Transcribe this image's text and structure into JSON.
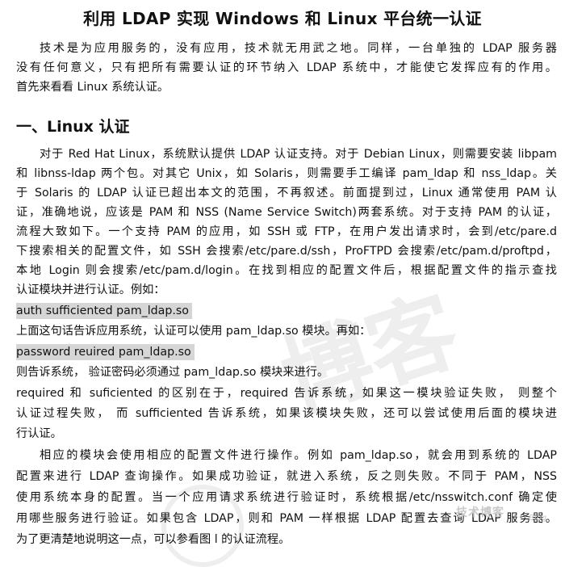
{
  "title": "利用 LDAP 实现 Windows 和 Linux 平台统一认证",
  "intro_lines": [
    "技术是为应用服务的，没有应用，技术就无用武之地。同样，一台单独的 LDAP 服务器",
    "没有任何意义，只有把所有需要认证的环节纳入 LDAP 系统中，才能使它发挥应有的作用。",
    "首先来看看 Linux 系统认证。"
  ],
  "section_heading": "一、Linux 认证",
  "para1_lines": [
    "对于 Red Hat Linux，系统默认提供 LDAP 认证支持。对于 Debian Linux，则需要安装 libpam",
    "和 libnss-ldap 两个包。对其它 Unix，如 Solaris，则需要手工编译 pam_ldap 和 nss_ldap。关",
    "于 Solaris 的 LDAP 认证已超出本文的范围，不再叙述。前面提到过，Linux 通常使用 PAM 认",
    "证，准确地说，应该是 PAM 和 NSS (Name Service Switch)两套系统。对于支持 PAM 的认证，",
    "流程大致如下。一个支持 PAM 的应用，如 SSH 或 FTP，在用户发出请求时，会到/etc/pare.d",
    "下搜索相关的配置文件，如 SSH 会搜索/etc/pare.d/ssh，ProFTPD 会搜索/etc/pam.d/proftpd，",
    "本地 Login 则会搜索/etc/pam.d/login。在找到相应的配置文件后，根据配置文件的指示查找",
    "认证模块并进行认证。例如："
  ],
  "code1": "auth sufficiented pam_ldap.so",
  "after_code1": "上面这句话告诉应用系统，认证可以使用 pam_ldap.so 模块。再如：",
  "code2": "password reuired pam_ldap.so",
  "after_code2": "则告诉系统， 验证密码必须通过 pam_ldap.so 模块来进行。",
  "para2_lines": [
    "required 和 suficiented 的区别在于，required 告诉系统，如果这一模块验证失败， 则整个",
    "认证过程失败， 而 sufficiented 告诉系统，如果该模块失败，还可以尝试使用后面的模块进",
    "行认证。"
  ],
  "para3_lines": [
    "相应的模块会使用相应的配置文件进行操作。例如 pam_ldap.so，就会用到系统的 LDAP",
    "配置来进行 LDAP 查询操作。如果成功验证，就进入系统，反之则失败。不同于 PAM，NSS",
    "使用系统本身的配置。当一个应用请求系统进行验证时，系统根据/etc/nsswitch.conf 确定使",
    "用哪些服务进行验证。如果包含 LDAP，则和 PAM 一样根据 LDAP 配置去查询 LDAP 服务器。",
    "为了更清楚地说明这一点，可以参看图 l 的认证流程。"
  ],
  "watermark": {
    "large_text": "博客",
    "badge_text": "技术博客",
    "blog_text": "Blog",
    "color": "#c9c9c9"
  },
  "colors": {
    "text": "#111111",
    "code_highlight": "#d6d6d6",
    "background": "#ffffff"
  }
}
